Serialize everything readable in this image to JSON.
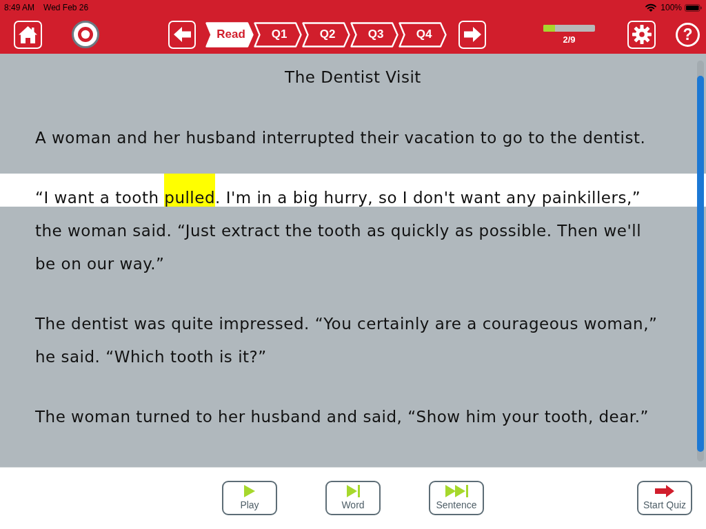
{
  "status_bar": {
    "time": "8:49 AM",
    "date": "Wed Feb 26",
    "battery": "100%"
  },
  "toolbar": {
    "tabs": [
      {
        "label": "Read",
        "selected": true
      },
      {
        "label": "Q1",
        "selected": false
      },
      {
        "label": "Q2",
        "selected": false
      },
      {
        "label": "Q3",
        "selected": false
      },
      {
        "label": "Q4",
        "selected": false
      }
    ],
    "progress": {
      "level": 0.22,
      "reading": "2/9"
    },
    "help_button": {
      "label": "?"
    }
  },
  "passage": {
    "title": "The Dentist Visit",
    "paragraphs": [
      {
        "lines": [
          {
            "current": false,
            "segments": [
              {
                "text": "A woman and her husband interrupted their vacation to go to the dentist.",
                "highlighted": false
              }
            ]
          }
        ]
      },
      {
        "lines": [
          {
            "current": true,
            "segments": [
              {
                "text": "“I want a tooth ",
                "highlighted": false
              },
              {
                "text": "pulled",
                "highlighted": true
              },
              {
                "text": ". I'm in a big hurry, so I don't want any painkillers,”",
                "highlighted": false
              }
            ]
          },
          {
            "current": false,
            "segments": [
              {
                "text": "the woman said. “Just extract the tooth as quickly as possible. Then we'll",
                "highlighted": false
              }
            ]
          },
          {
            "current": false,
            "segments": [
              {
                "text": "be on our way.”",
                "highlighted": false
              }
            ]
          }
        ]
      },
      {
        "lines": [
          {
            "current": false,
            "segments": [
              {
                "text": "The dentist was quite impressed. “You certainly are a courageous woman,”",
                "highlighted": false
              }
            ]
          },
          {
            "current": false,
            "segments": [
              {
                "text": "he said. “Which tooth is it?”",
                "highlighted": false
              }
            ]
          }
        ]
      },
      {
        "lines": [
          {
            "current": false,
            "segments": [
              {
                "text": "The woman turned to her husband and said, “Show him your tooth, dear.”",
                "highlighted": false
              }
            ]
          }
        ]
      }
    ]
  },
  "bottom_bar": {
    "playback_buttons": [
      {
        "label": "Play",
        "kind": "play"
      },
      {
        "label": "Word",
        "kind": "word"
      },
      {
        "label": "Sentence",
        "kind": "sentence"
      }
    ],
    "start_quiz": {
      "label": "Start Quiz"
    }
  }
}
